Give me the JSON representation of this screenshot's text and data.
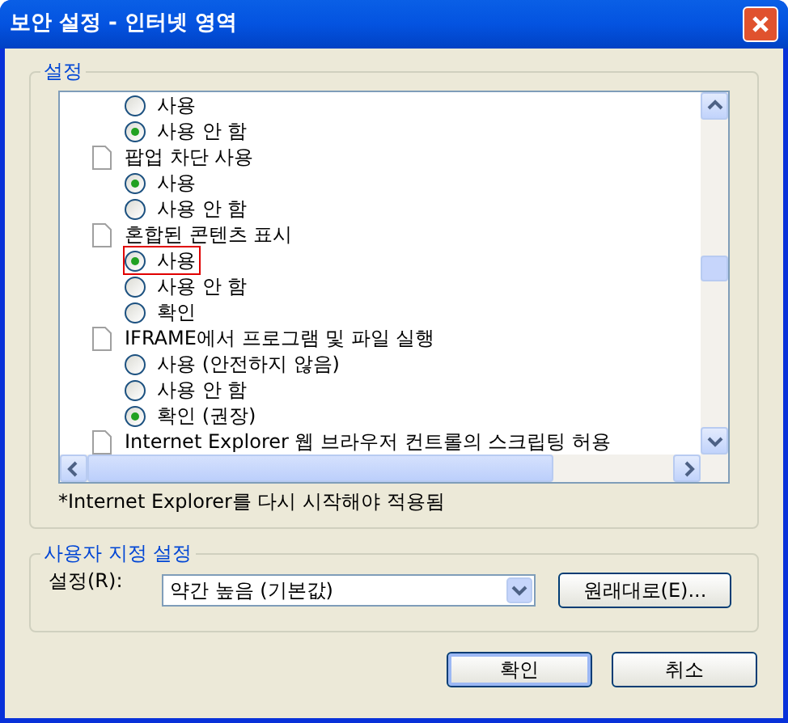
{
  "window": {
    "title": "보안 설정 - 인터넷 영역"
  },
  "settings_group": {
    "title": "설정",
    "items": [
      {
        "kind": "option",
        "label": "사용",
        "selected": false,
        "outlined": false
      },
      {
        "kind": "option",
        "label": "사용 안 함",
        "selected": true,
        "outlined": false
      },
      {
        "kind": "setting",
        "label": "팝업 차단 사용",
        "children": [
          {
            "kind": "option",
            "label": "사용",
            "selected": true,
            "outlined": false
          },
          {
            "kind": "option",
            "label": "사용 안 함",
            "selected": false,
            "outlined": false
          }
        ]
      },
      {
        "kind": "setting",
        "label": "혼합된 콘텐츠 표시",
        "children": [
          {
            "kind": "option",
            "label": "사용",
            "selected": true,
            "outlined": true
          },
          {
            "kind": "option",
            "label": "사용 안 함",
            "selected": false,
            "outlined": false
          },
          {
            "kind": "option",
            "label": "확인",
            "selected": false,
            "outlined": false
          }
        ]
      },
      {
        "kind": "setting",
        "label": "IFRAME에서 프로그램 및 파일 실행",
        "children": [
          {
            "kind": "option",
            "label": "사용 (안전하지 않음)",
            "selected": false,
            "outlined": false
          },
          {
            "kind": "option",
            "label": "사용 안 함",
            "selected": false,
            "outlined": false
          },
          {
            "kind": "option",
            "label": "확인 (권장)",
            "selected": true,
            "outlined": false
          }
        ]
      },
      {
        "kind": "setting",
        "label": "Internet Explorer 웹 브라우저 컨트롤의 스크립팅 허용"
      }
    ],
    "note": "*Internet Explorer를 다시 시작해야 적용됨"
  },
  "custom_group": {
    "title": "사용자 지정 설정",
    "label": "설정(R):",
    "value": "약간 높음 (기본값)",
    "reset_button": "원래대로(E)..."
  },
  "buttons": [
    "확인",
    "취소"
  ]
}
